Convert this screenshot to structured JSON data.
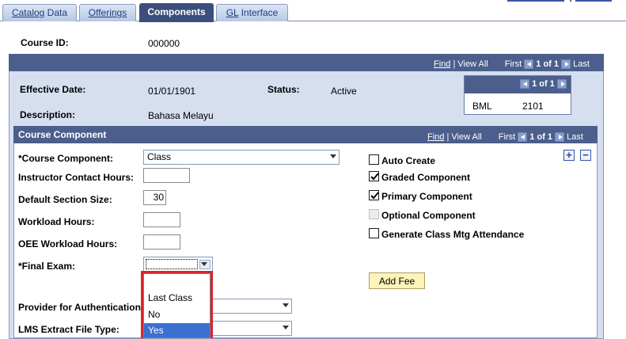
{
  "tabs": [
    {
      "label": "Catalog Data",
      "active": false
    },
    {
      "label": "Offerings",
      "active": false
    },
    {
      "label": "Components",
      "active": true
    },
    {
      "label": "GL Interface",
      "active": false
    }
  ],
  "course": {
    "id_label": "Course ID:",
    "id_value": "000000"
  },
  "main_nav": {
    "find": "Find",
    "sep": "|",
    "view_all": "View All",
    "first": "First",
    "pos": "1 of 1",
    "last": "Last"
  },
  "effective": {
    "date_label": "Effective Date:",
    "date_value": "01/01/1901",
    "status_label": "Status:",
    "status_value": "Active",
    "desc_label": "Description:",
    "desc_value": "Bahasa Melayu"
  },
  "side_grid": {
    "pos": "1 of 1",
    "col1": "BML",
    "col2": "2101"
  },
  "component_section": {
    "title": "Course Component",
    "nav": {
      "find": "Find",
      "sep": "|",
      "view_all": "View All",
      "first": "First",
      "pos": "1 of 1",
      "last": "Last"
    }
  },
  "fields": {
    "course_component_label": "*Course Component:",
    "course_component_value": "Class",
    "instructor_hours_label": "Instructor Contact Hours:",
    "instructor_hours_value": "",
    "section_size_label": "Default Section Size:",
    "section_size_value": "30",
    "workload_label": "Workload Hours:",
    "workload_value": "",
    "oee_label": "OEE Workload Hours:",
    "oee_value": "",
    "final_exam_label": "*Final Exam:",
    "final_exam_value": "",
    "provider_label": "Provider for Authentication",
    "lms_label": "LMS Extract File Type:"
  },
  "checkboxes": [
    {
      "label": "Auto Create",
      "checked": false,
      "disabled": false
    },
    {
      "label": "Graded Component",
      "checked": true,
      "disabled": false
    },
    {
      "label": "Primary Component",
      "checked": true,
      "disabled": false
    },
    {
      "label": "Optional Component",
      "checked": false,
      "disabled": true
    },
    {
      "label": "Generate Class Mtg Attendance",
      "checked": false,
      "disabled": false
    }
  ],
  "add_fee_label": "Add Fee",
  "row_buttons": {
    "add": "+",
    "remove": "−"
  },
  "final_exam_options": [
    "Last Class",
    "No",
    "Yes"
  ],
  "colors": {
    "header_bar": "#4c5f8c",
    "highlight_box": "#d5262e",
    "selected_option": "#3b6fd0",
    "button": "#fcf4b8"
  }
}
